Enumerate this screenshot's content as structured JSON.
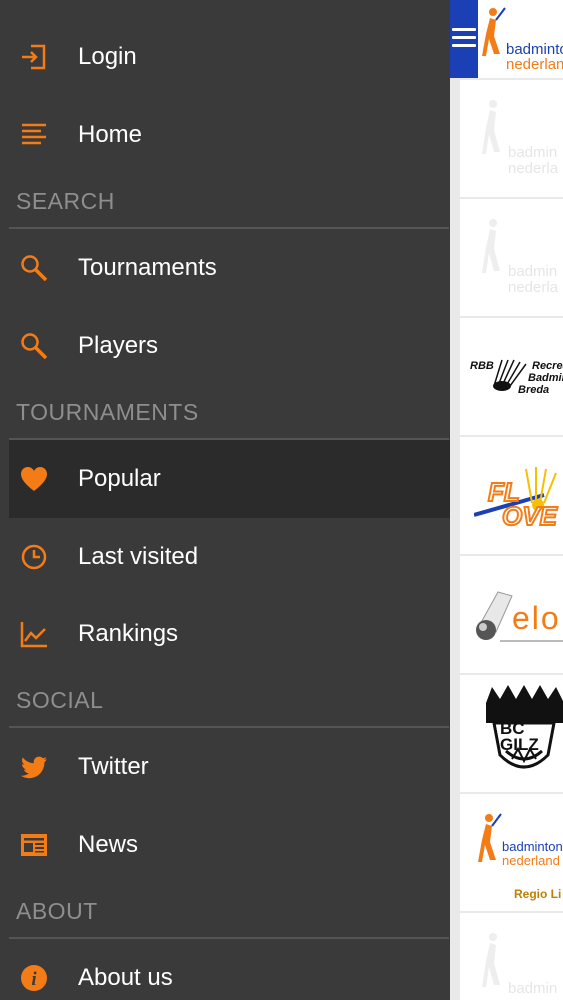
{
  "menu": {
    "login": "Login",
    "home": "Home",
    "section_search": "SEARCH",
    "tournaments": "Tournaments",
    "players": "Players",
    "section_tournaments": "TOURNAMENTS",
    "popular": "Popular",
    "last_visited": "Last visited",
    "rankings": "Rankings",
    "section_social": "SOCIAL",
    "twitter": "Twitter",
    "news": "News",
    "section_about": "ABOUT",
    "about_us": "About us"
  },
  "colors": {
    "accent": "#f47c17",
    "menu_bg": "#3a3a3a",
    "active_bg": "#2b2b2b",
    "topbar": "#1b3fb4"
  },
  "list": {
    "top_logo": {
      "line1": "badminton",
      "line2": "nederland"
    },
    "rows": [
      {
        "logo": "badminton-nederland-faded",
        "line1": "badmin",
        "line2": "nederla"
      },
      {
        "logo": "badminton-nederland-faded",
        "line1": "badmin",
        "line2": "nederla"
      },
      {
        "logo": "rbb-breda",
        "line1": "RBB",
        "line2": "Recrea",
        "line3": "Badmin",
        "line4": "Breda"
      },
      {
        "logo": "flow-over",
        "line1": "FL",
        "line2": "OVE"
      },
      {
        "logo": "elo-badminton",
        "line1": "elo"
      },
      {
        "logo": "bc-gilze",
        "line1": "BC GILZ"
      },
      {
        "logo": "badminton-nederland-regio",
        "line1": "badminton",
        "line2": "nederland",
        "line3": "Regio Li"
      },
      {
        "logo": "badminton-nederland-faded",
        "line1": "badmin"
      }
    ]
  }
}
